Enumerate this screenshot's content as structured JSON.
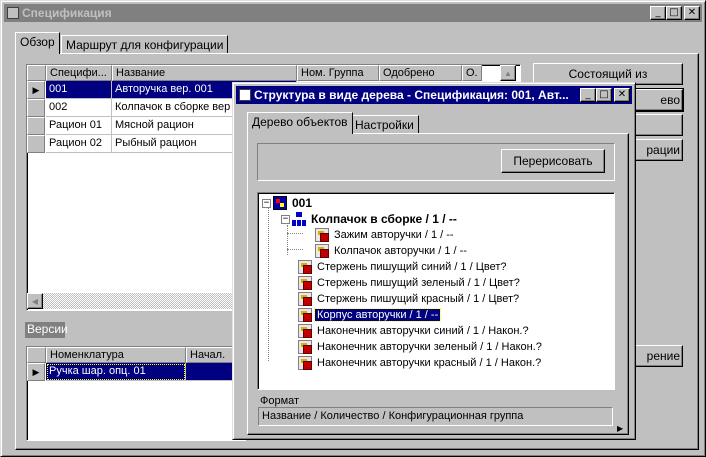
{
  "main_window": {
    "title": "Спецификация",
    "tabs": [
      "Обзор",
      "Маршрут для конфигурации"
    ],
    "grid": {
      "columns": [
        "Специфи...",
        "Название",
        "Ном. Группа",
        "Одобрено",
        "О."
      ],
      "rows": [
        {
          "spec": "001",
          "name": "Авторучка вер. 001",
          "selected": true
        },
        {
          "spec": "002",
          "name": "Колпачок в сборке вер"
        },
        {
          "spec": "Рацион 01",
          "name": "Мясной рацион"
        },
        {
          "spec": "Рацион 02",
          "name": "Рыбный рацион"
        }
      ]
    },
    "right_buttons": [
      "Состоящий из",
      "ево",
      "рации",
      "рение"
    ],
    "versions": {
      "title": "Версии",
      "columns": [
        "Номенклатура",
        "Начал."
      ],
      "rows": [
        {
          "item": "Ручка шар. опц. 01"
        }
      ]
    }
  },
  "tree_window": {
    "title": "Структура в виде дерева - Спецификация: 001, Авт...",
    "tabs": [
      "Дерево объектов",
      "Настройки"
    ],
    "redraw_button": "Перерисовать",
    "tree": {
      "root": "001",
      "assembly": "Колпачок в сборке / 1 / --",
      "assembly_children": [
        "Зажим авторучки / 1 / --",
        "Колпачок авторучки / 1 / --"
      ],
      "items": [
        {
          "label": "Стержень пишущий синий / 1 / Цвет?"
        },
        {
          "label": "Стержень пишущий зеленый / 1 / Цвет?"
        },
        {
          "label": "Стержень пишущий красный / 1 / Цвет?"
        },
        {
          "label": "Корпус авторучки / 1 / --",
          "selected": true
        },
        {
          "label": "Наконечник авторучки синий / 1 / Након.?"
        },
        {
          "label": "Наконечник авторучки зеленый / 1 / Након.?"
        },
        {
          "label": "Наконечник авторучки красный / 1 / Након.?"
        }
      ]
    },
    "format_label": "Формат",
    "format_value": "Название  / Количество / Конфигурационная группа"
  },
  "title_buttons": {
    "minimize": "_",
    "maximize": "□",
    "close": "✕"
  },
  "colors": {
    "selection": "#000080",
    "active_title": "#000080",
    "inactive_title": "#808080"
  }
}
